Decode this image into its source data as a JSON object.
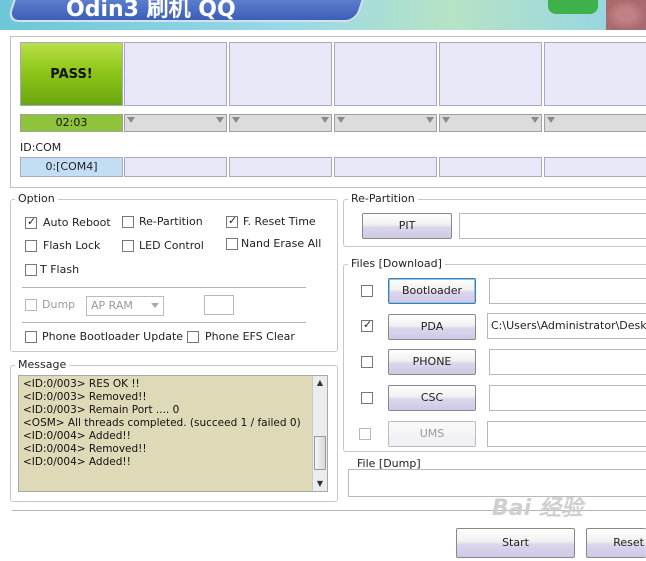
{
  "banner": {
    "title": "Odin3 刷机 QQ"
  },
  "ports": {
    "slot1_status": "PASS!",
    "slot1_time": "02:03",
    "id_label": "ID:COM",
    "slot1_id": "0:[COM4]"
  },
  "option": {
    "title": "Option",
    "auto_reboot": "Auto Reboot",
    "re_partition": "Re-Partition",
    "f_reset_time": "F. Reset Time",
    "flash_lock": "Flash Lock",
    "led_control": "LED Control",
    "nand_erase_all": "Nand Erase All",
    "t_flash": "T Flash",
    "dump": "Dump",
    "dump_select": "AP RAM",
    "phone_bootloader_update": "Phone Bootloader Update",
    "phone_efs_clear": "Phone EFS Clear"
  },
  "message": {
    "title": "Message",
    "lines": [
      "<ID:0/003> RES OK !!",
      "<ID:0/003> Removed!!",
      "<ID:0/003> Remain Port ....  0",
      "<OSM> All threads completed. (succeed 1 / failed 0)",
      "<ID:0/004> Added!!",
      "<ID:0/004> Removed!!",
      "<ID:0/004> Added!!"
    ]
  },
  "repartition": {
    "title": "Re-Partition",
    "pit": "PIT"
  },
  "files": {
    "title": "Files [Download]",
    "bootloader": "Bootloader",
    "pda": "PDA",
    "pda_path": "C:\\Users\\Administrator\\Desktop\\",
    "phone": "PHONE",
    "csc": "CSC",
    "ums": "UMS"
  },
  "dump": {
    "title": "File [Dump]"
  },
  "actions": {
    "start": "Start",
    "reset": "Reset"
  },
  "watermark": "Bai 经验"
}
